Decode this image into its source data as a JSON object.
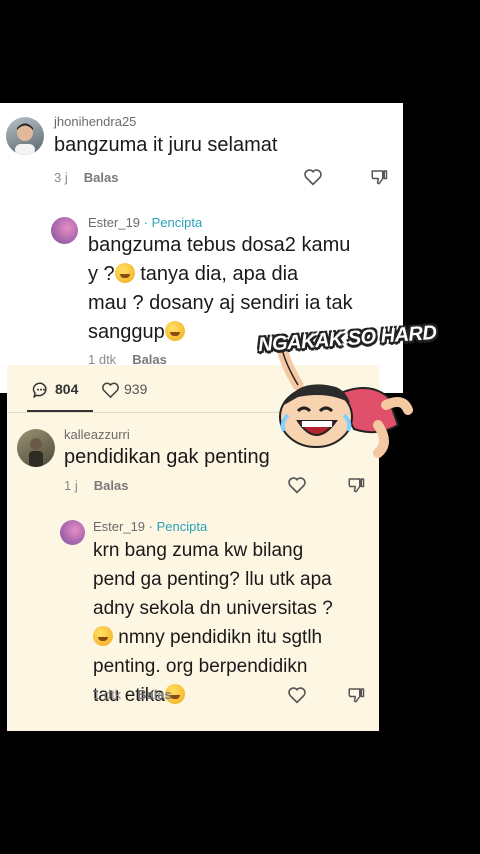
{
  "thread1": {
    "comment": {
      "username": "jhonihendra25",
      "text": "bangzuma it juru selamat",
      "time": "3 j",
      "reply_label": "Balas"
    },
    "reply": {
      "username": "Ester_19",
      "creator_tag": " · Pencipta",
      "text_line1": "bangzuma tebus dosa2 kamu",
      "text_line2a": "y ?",
      "text_line2b": " tanya dia, apa dia",
      "text_line3": "mau ? dosany aj sendiri ia tak",
      "text_line4": "sanggup",
      "time": "1 dtk",
      "reply_label": "Balas"
    }
  },
  "sticker": {
    "caption": "NGAKAK SO HARD"
  },
  "thread2": {
    "stats": {
      "comments": "804",
      "likes": "939"
    },
    "comment": {
      "username": "kalleazzurri",
      "text": "pendidikan gak penting",
      "time": "1 j",
      "reply_label": "Balas"
    },
    "reply": {
      "username": "Ester_19",
      "creator_tag": " · Pencipta",
      "text_line1": "krn bang zuma kw bilang",
      "text_line2": "pend ga penting? llu utk apa",
      "text_line3": "adny sekola dn universitas ?",
      "text_line4": " nmny pendidikn itu sgtlh",
      "text_line5": "penting. org berpendidikn",
      "text_line6": "tau etika",
      "time": "1 dtk",
      "reply_label": "Balas"
    }
  }
}
